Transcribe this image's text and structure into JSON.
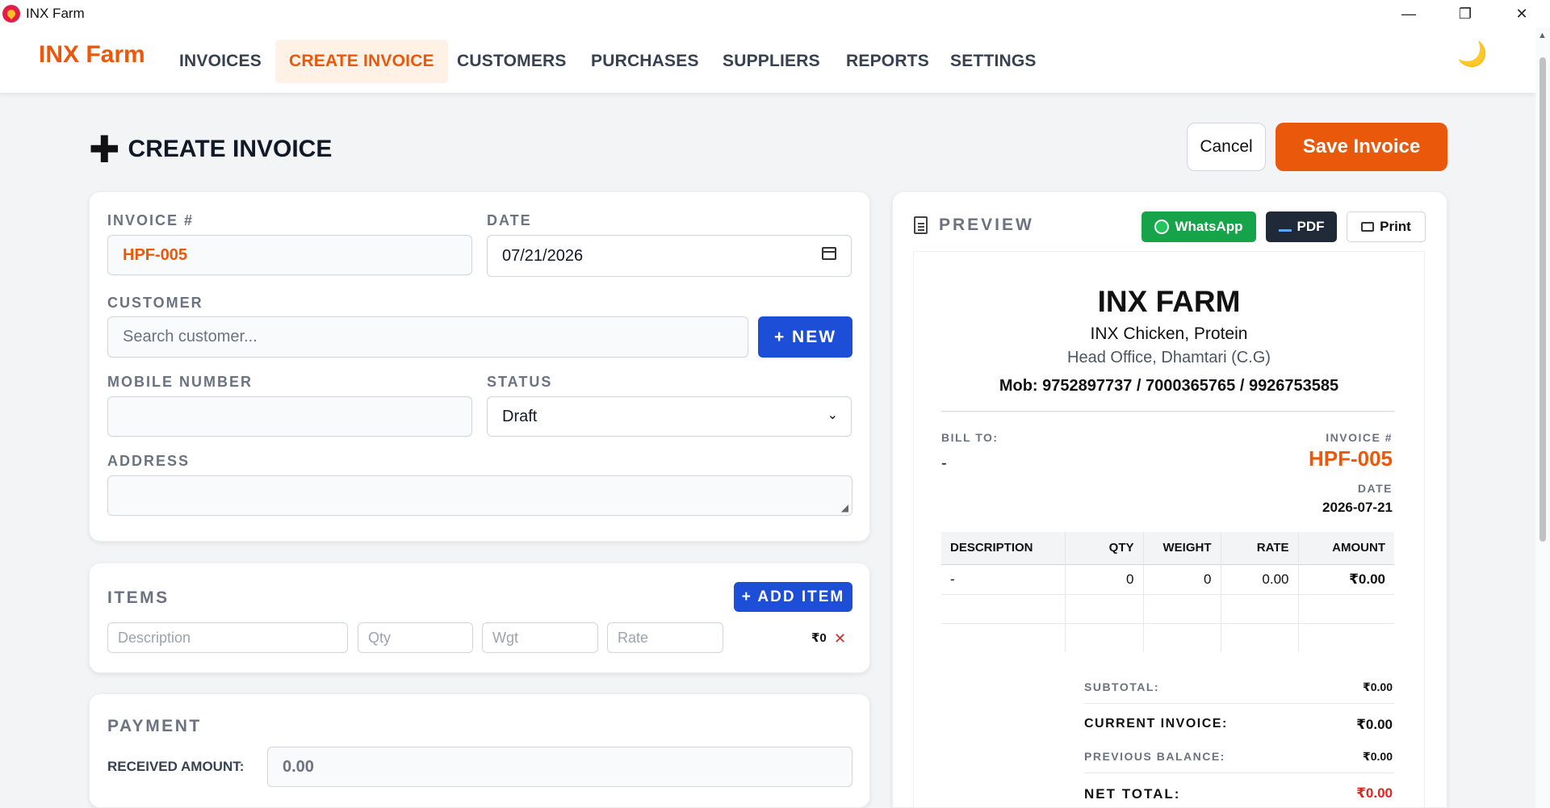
{
  "window": {
    "title": "INX Farm",
    "minimize": "—",
    "restore": "❐",
    "close": "✕"
  },
  "nav": {
    "brand": "INX Farm",
    "items": [
      {
        "label": "INVOICES"
      },
      {
        "label": "CREATE INVOICE"
      },
      {
        "label": "CUSTOMERS"
      },
      {
        "label": "PURCHASES"
      },
      {
        "label": "SUPPLIERS"
      },
      {
        "label": "REPORTS"
      },
      {
        "label": "SETTINGS"
      }
    ],
    "active": "CREATE INVOICE",
    "theme_icon": "🌙"
  },
  "header": {
    "title": "CREATE INVOICE",
    "icon": "✚",
    "cancel_label": "Cancel",
    "save_label": "Save Invoice"
  },
  "form": {
    "invoice_label": "INVOICE #",
    "invoice_value": "HPF-005",
    "date_label": "DATE",
    "date_value": "07/21/2026",
    "customer_label": "CUSTOMER",
    "customer_placeholder": "Search customer...",
    "new_label": "+ NEW",
    "mobile_label": "MOBILE NUMBER",
    "mobile_value": "",
    "status_label": "STATUS",
    "status_value": "Draft",
    "address_label": "ADDRESS",
    "address_value": ""
  },
  "items": {
    "title": "ITEMS",
    "add_label": "+ ADD ITEM",
    "description_placeholder": "Description",
    "qty_placeholder": "Qty",
    "wgt_placeholder": "Wgt",
    "rate_placeholder": "Rate",
    "row_total": "₹0",
    "remove_icon": "✕"
  },
  "payment": {
    "title": "PAYMENT",
    "received_label": "RECEIVED AMOUNT:",
    "received_value": "0.00"
  },
  "preview": {
    "label": "PREVIEW",
    "whatsapp_label": "WhatsApp",
    "pdf_label": "PDF",
    "print_label": "Print",
    "company_name": "INX FARM",
    "company_sub": "INX Chicken, Protein",
    "company_addr": "Head Office, Dhamtari (C.G)",
    "company_mob": "Mob: 9752897737 / 7000365765 / 9926753585",
    "bill_to_label": "BILL TO:",
    "bill_to_value": "-",
    "invoice_label": "INVOICE #",
    "invoice_value": "HPF-005",
    "date_label": "DATE",
    "date_value": "2026-07-21",
    "table": {
      "headers": [
        "DESCRIPTION",
        "QTY",
        "WEIGHT",
        "RATE",
        "AMOUNT"
      ],
      "row": [
        "-",
        "0",
        "0",
        "0.00",
        "₹0.00"
      ]
    },
    "subtotal_label": "SUBTOTAL:",
    "subtotal_value": "₹0.00",
    "current_label": "CURRENT INVOICE:",
    "current_value": "₹0.00",
    "previous_label": "PREVIOUS BALANCE:",
    "previous_value": "₹0.00",
    "net_label": "NET TOTAL:",
    "net_value": "₹0.00"
  },
  "colors": {
    "accent": "#ea580c",
    "blue": "#1d4ed8",
    "whatsapp": "#16a34a",
    "danger": "#dc2626"
  }
}
